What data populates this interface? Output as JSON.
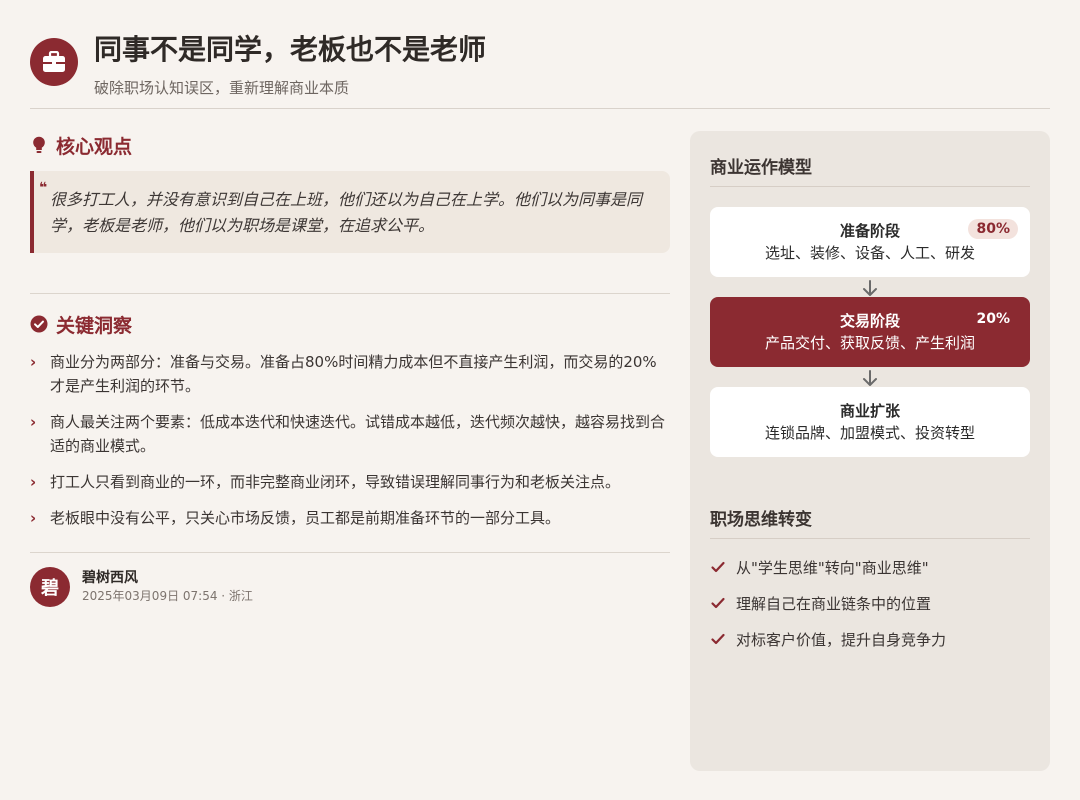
{
  "header": {
    "title": "同事不是同学，老板也不是老师",
    "subtitle": "破除职场认知误区，重新理解商业本质",
    "icon": "briefcase-icon"
  },
  "core": {
    "section_title": "核心观点",
    "icon": "lightbulb-icon",
    "quote": "很多打工人，并没有意识到自己在上班，他们还以为自己在上学。他们以为同事是同学，老板是老师，他们以为职场是课堂，在追求公平。"
  },
  "insights": {
    "section_title": "关键洞察",
    "icon": "check-circle-icon",
    "items": [
      "商业分为两部分：准备与交易。准备占80%时间精力成本但不直接产生利润，而交易的20%才是产生利润的环节。",
      "商人最关注两个要素：低成本迭代和快速迭代。试错成本越低，迭代频次越快，越容易找到合适的商业模式。",
      "打工人只看到商业的一环，而非完整商业闭环，导致错误理解同事行为和老板关注点。",
      "老板眼中没有公平，只关心市场反馈，员工都是前期准备环节的一部分工具。"
    ]
  },
  "author": {
    "avatar_text": "碧",
    "name": "碧树西风",
    "meta": "2025年03月09日 07:54 · 浙江"
  },
  "model": {
    "title": "商业运作模型",
    "stages": [
      {
        "title": "准备阶段",
        "desc": "选址、装修、设备、人工、研发",
        "badge": "80%"
      },
      {
        "title": "交易阶段",
        "desc": "产品交付、获取反馈、产生利润",
        "badge": "20%"
      },
      {
        "title": "商业扩张",
        "desc": "连锁品牌、加盟模式、投资转型",
        "badge": ""
      }
    ]
  },
  "mindset": {
    "title": "职场思维转变",
    "items": [
      "从\"学生思维\"转向\"商业思维\"",
      "理解自己在商业链条中的位置",
      "对标客户价值，提升自身竞争力"
    ]
  },
  "colors": {
    "accent": "#8b2a31",
    "background": "#f7f3ef",
    "panel": "#ebe6e0"
  }
}
